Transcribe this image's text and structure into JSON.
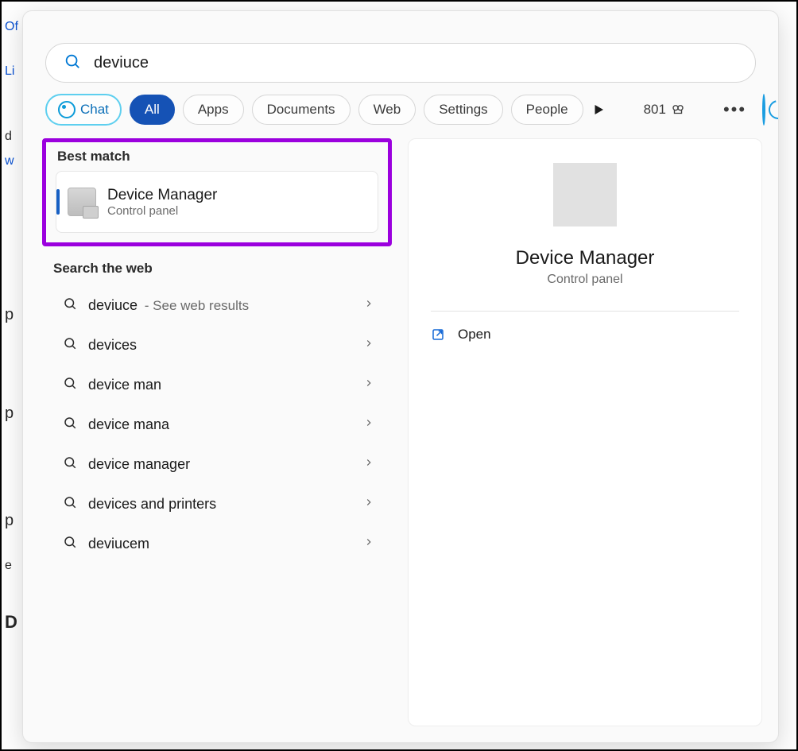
{
  "search": {
    "query": "deviuce"
  },
  "filters": {
    "chat": "Chat",
    "all": "All",
    "apps": "Apps",
    "documents": "Documents",
    "web": "Web",
    "settings": "Settings",
    "people": "People"
  },
  "header": {
    "points": "801"
  },
  "sections": {
    "best_match": "Best match",
    "search_web": "Search the web"
  },
  "best_match": {
    "title": "Device Manager",
    "subtitle": "Control panel"
  },
  "web_suggestions": [
    {
      "label": "deviuce",
      "suffix": " - See web results"
    },
    {
      "label": "devices",
      "suffix": ""
    },
    {
      "label": "device man",
      "suffix": ""
    },
    {
      "label": "device mana",
      "suffix": ""
    },
    {
      "label": "device manager",
      "suffix": ""
    },
    {
      "label": "devices and printers",
      "suffix": ""
    },
    {
      "label": "deviucem",
      "suffix": ""
    }
  ],
  "detail": {
    "title": "Device Manager",
    "subtitle": "Control panel",
    "actions": {
      "open": "Open"
    }
  },
  "annotation": {
    "highlight_color": "#9b00de"
  }
}
